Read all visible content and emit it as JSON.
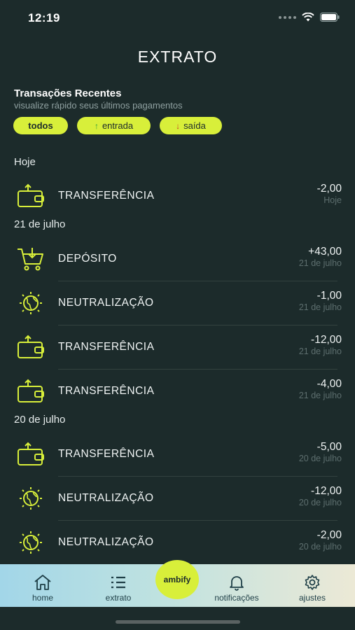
{
  "status": {
    "time": "12:19"
  },
  "page": {
    "title": "EXTRATO"
  },
  "section": {
    "title": "Transações Recentes",
    "subtitle": "visualize rápido seus últimos pagamentos"
  },
  "filters": {
    "todos": "todos",
    "entrada": "entrada",
    "saida": "saída"
  },
  "groups": [
    "Hoje",
    "21 de julho",
    "20 de julho"
  ],
  "transactions": [
    {
      "name": "TRANSFERÊNCIA",
      "amount": "-2,00",
      "date": "Hoje",
      "icon": "wallet-icon"
    },
    {
      "name": "DEPÓSITO",
      "amount": "+43,00",
      "date": "21 de julho",
      "icon": "cart-icon"
    },
    {
      "name": "NEUTRALIZAÇÃO",
      "amount": "-1,00",
      "date": "21 de julho",
      "icon": "globe-icon"
    },
    {
      "name": "TRANSFERÊNCIA",
      "amount": "-12,00",
      "date": "21 de julho",
      "icon": "wallet-icon"
    },
    {
      "name": "TRANSFERÊNCIA",
      "amount": "-4,00",
      "date": "21 de julho",
      "icon": "wallet-icon"
    },
    {
      "name": "TRANSFERÊNCIA",
      "amount": "-5,00",
      "date": "20 de julho",
      "icon": "wallet-icon"
    },
    {
      "name": "NEUTRALIZAÇÃO",
      "amount": "-12,00",
      "date": "20 de julho",
      "icon": "globe-icon"
    },
    {
      "name": "NEUTRALIZAÇÃO",
      "amount": "-2,00",
      "date": "20 de julho",
      "icon": "globe-icon"
    }
  ],
  "nav": {
    "home": "home",
    "extrato": "extrato",
    "center": "ambify",
    "notificacoes": "notificações",
    "ajustes": "ajustes"
  },
  "colors": {
    "background": "#1c2b2b",
    "accent": "#d8ef3a",
    "muted": "#5d6e6e"
  }
}
